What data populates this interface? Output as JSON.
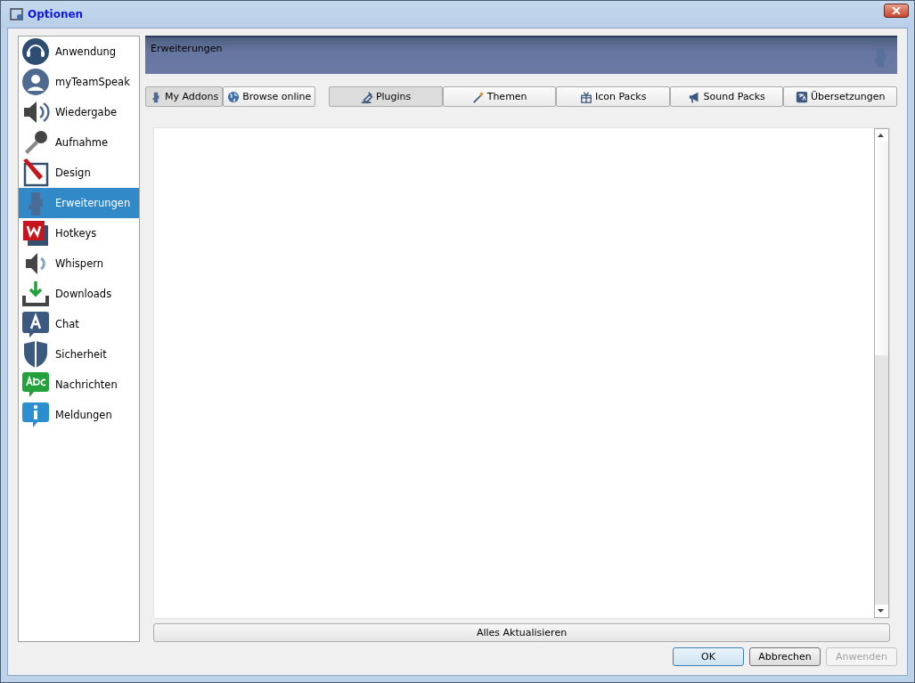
{
  "window": {
    "title": "Optionen"
  },
  "sidebar": {
    "items": [
      {
        "label": "Anwendung",
        "selected": false
      },
      {
        "label": "myTeamSpeak",
        "selected": false
      },
      {
        "label": "Wiedergabe",
        "selected": false
      },
      {
        "label": "Aufnahme",
        "selected": false
      },
      {
        "label": "Design",
        "selected": false
      },
      {
        "label": "Erweiterungen",
        "selected": true
      },
      {
        "label": "Hotkeys",
        "selected": false
      },
      {
        "label": "Whispern",
        "selected": false
      },
      {
        "label": "Downloads",
        "selected": false
      },
      {
        "label": "Chat",
        "selected": false
      },
      {
        "label": "Sicherheit",
        "selected": false
      },
      {
        "label": "Nachrichten",
        "selected": false
      },
      {
        "label": "Meldungen",
        "selected": false
      }
    ]
  },
  "banner": {
    "title": "Erweiterungen"
  },
  "source_tabs": [
    {
      "label": "My Addons",
      "selected": true
    },
    {
      "label": "Browse online",
      "selected": false
    }
  ],
  "category_tabs": [
    {
      "label": "Plugins",
      "selected": true
    },
    {
      "label": "Themen",
      "selected": false
    },
    {
      "label": "Icon Packs",
      "selected": false
    },
    {
      "label": "Sound Packs",
      "selected": false
    },
    {
      "label": "Übersetzungen",
      "selected": false
    }
  ],
  "update_button": "Alles Aktualisieren",
  "buttons": [
    {
      "label": "OK",
      "disabled": false
    },
    {
      "label": "Abbrechen",
      "disabled": false
    },
    {
      "label": "Anwenden",
      "disabled": true
    }
  ]
}
